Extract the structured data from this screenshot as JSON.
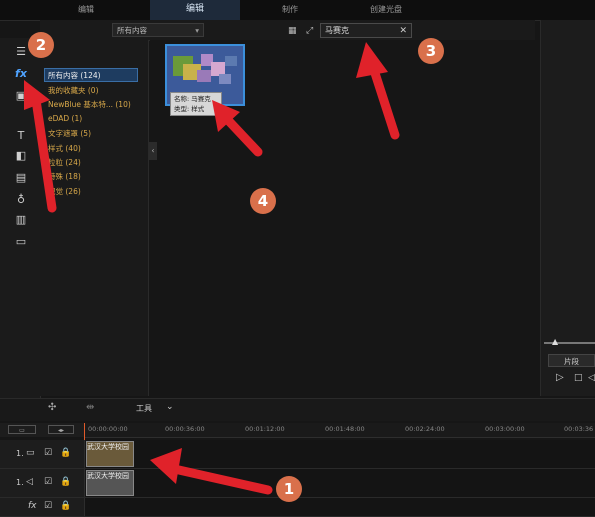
{
  "top_tabs": [
    "编辑",
    "编辑",
    "制作",
    "创建光盘"
  ],
  "filter_dropdown": "所有内容",
  "search": {
    "value": "马赛克"
  },
  "categories": [
    {
      "label": "所有内容 (124)"
    },
    {
      "label": "我的收藏夹 (0)"
    },
    {
      "label": "NewBlue 基本特... (10)"
    },
    {
      "label": "eDAD (1)"
    },
    {
      "label": "文字遮罩 (5)"
    },
    {
      "label": "样式 (40)"
    },
    {
      "label": "粒粒 (24)"
    },
    {
      "label": "特殊 (18)"
    },
    {
      "label": "视觉 (26)"
    }
  ],
  "tooltip": {
    "line1": "名称: 马赛克",
    "line2": "类型: 样式"
  },
  "toolbar": {
    "tools_label": "工具"
  },
  "ruler_ticks": [
    "00:00:00:00",
    "00:00:36:00",
    "00:01:12:00",
    "00:01:48:00",
    "00:02:24:00",
    "00:03:00:00",
    "00:03:36"
  ],
  "tracks": [
    {
      "label": "1.",
      "clip": "武汉大学校园"
    },
    {
      "label": "1.",
      "clip": "武汉大学校园"
    },
    {
      "label": "fx"
    }
  ],
  "preview": {
    "clip_label": "片段"
  },
  "badges": {
    "b1": "1",
    "b2": "2",
    "b3": "3",
    "b4": "4"
  },
  "colors": {
    "accent": "#3b8fdb",
    "category_text": "#d9a94a",
    "badge": "#d9704b",
    "arrow": "#e0222a"
  }
}
